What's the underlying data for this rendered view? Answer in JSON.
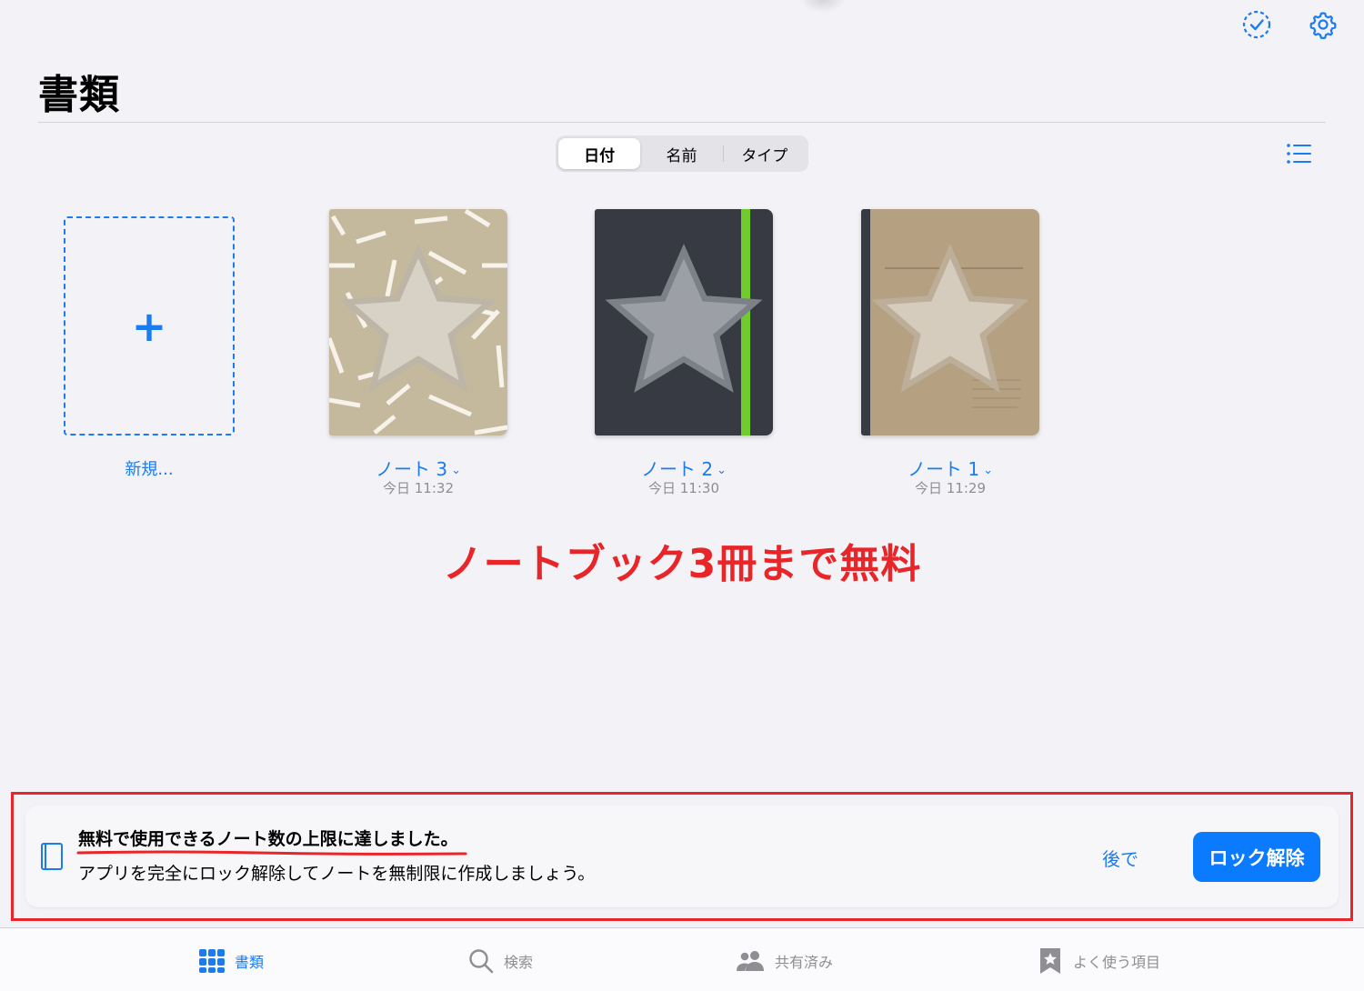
{
  "header": {
    "title": "書類",
    "select_icon": "checkmark-circle-dashed-icon",
    "settings_icon": "gear-icon"
  },
  "sort": {
    "options": [
      "日付",
      "名前",
      "タイプ"
    ],
    "selected": "日付"
  },
  "view_toggle_icon": "list-icon",
  "new_item": {
    "label": "新規..."
  },
  "notebooks": [
    {
      "name": "ノート 3",
      "date": "今日 11:32",
      "cover": "beige-confetti"
    },
    {
      "name": "ノート 2",
      "date": "今日 11:30",
      "cover": "charcoal-green-band"
    },
    {
      "name": "ノート 1",
      "date": "今日 11:29",
      "cover": "kraft"
    }
  ],
  "annotation": "ノートブック3冊まで無料",
  "banner": {
    "title": "無料で使用できるノート数の上限に達しました。",
    "subtitle": "アプリを完全にロック解除してノートを無制限に作成しましょう。",
    "later": "後で",
    "unlock": "ロック解除"
  },
  "tabs": [
    {
      "label": "書類",
      "icon": "grid-icon",
      "active": true
    },
    {
      "label": "検索",
      "icon": "magnifier-icon",
      "active": false
    },
    {
      "label": "共有済み",
      "icon": "people-icon",
      "active": false
    },
    {
      "label": "よく使う項目",
      "icon": "bookmark-star-icon",
      "active": false
    }
  ],
  "colors": {
    "accent": "#1a7cf0",
    "annotation_red": "#e8262a",
    "background": "#f2f2f7"
  }
}
